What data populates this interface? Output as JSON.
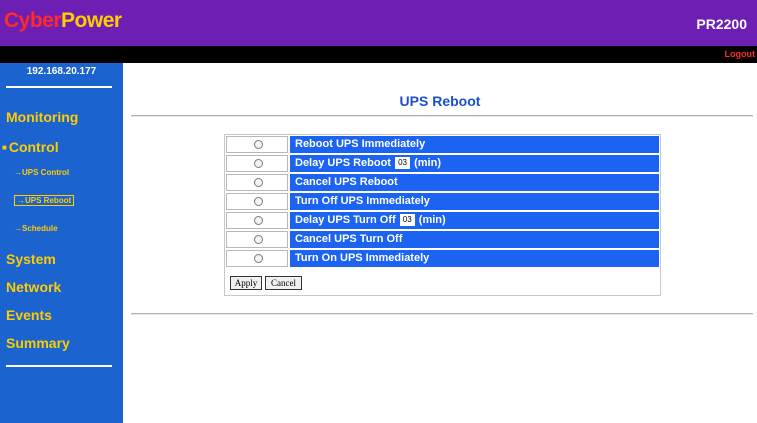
{
  "header": {
    "logo_part1": "Cyber",
    "logo_part2": "Power",
    "model": "PR2200",
    "logout_label": "Logout"
  },
  "sidebar": {
    "ip": "192.168.20.177",
    "items": {
      "monitoring": "Monitoring",
      "control": "Control",
      "ups_control": "→UPS Control",
      "ups_reboot": "→UPS Reboot",
      "schedule": "→Schedule",
      "system": "System",
      "network": "Network",
      "events": "Events",
      "summary": "Summary"
    }
  },
  "main": {
    "title": "UPS Reboot",
    "options": [
      {
        "label": "Reboot UPS Immediately"
      },
      {
        "label_before": "Delay UPS Reboot",
        "value": "03",
        "label_after": "(min)"
      },
      {
        "label": "Cancel UPS Reboot"
      },
      {
        "label": "Turn Off UPS Immediately"
      },
      {
        "label_before": "Delay UPS Turn Off",
        "value": "03",
        "label_after": "(min)"
      },
      {
        "label": "Cancel UPS Turn Off"
      },
      {
        "label": "Turn On UPS Immediately"
      }
    ],
    "apply_label": "Apply",
    "cancel_label": "Cancel"
  },
  "colors": {
    "header_bg": "#6d1fb3",
    "sidebar_bg": "#1b63cf",
    "nav_text": "#ffcc00",
    "option_bg": "#1b63f0",
    "title_text": "#1b4fcc"
  }
}
